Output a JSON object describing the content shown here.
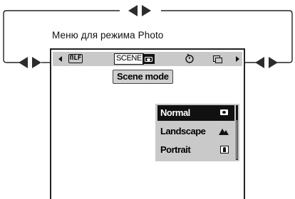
{
  "caption": "Меню для режима Photo",
  "menu_bar": {
    "quality_icon_text": "ΠĹF",
    "scene_label": "SCENE",
    "icons": [
      "chevron-left-icon",
      "quality-icon",
      "camera-icon",
      "self-timer-icon",
      "continuous-shooting-icon",
      "chevron-right-icon"
    ]
  },
  "scene_mode_label": "Scene mode",
  "scene_list": [
    {
      "label": "Normal",
      "icon": "camera-icon",
      "selected": true
    },
    {
      "label": "Landscape",
      "icon": "mountain-icon",
      "selected": false
    },
    {
      "label": "Portrait",
      "icon": "portrait-icon",
      "selected": false
    }
  ],
  "colors": {
    "bar_background": "#c9c9c9",
    "selected_row": "#111111",
    "line": "#222222"
  }
}
